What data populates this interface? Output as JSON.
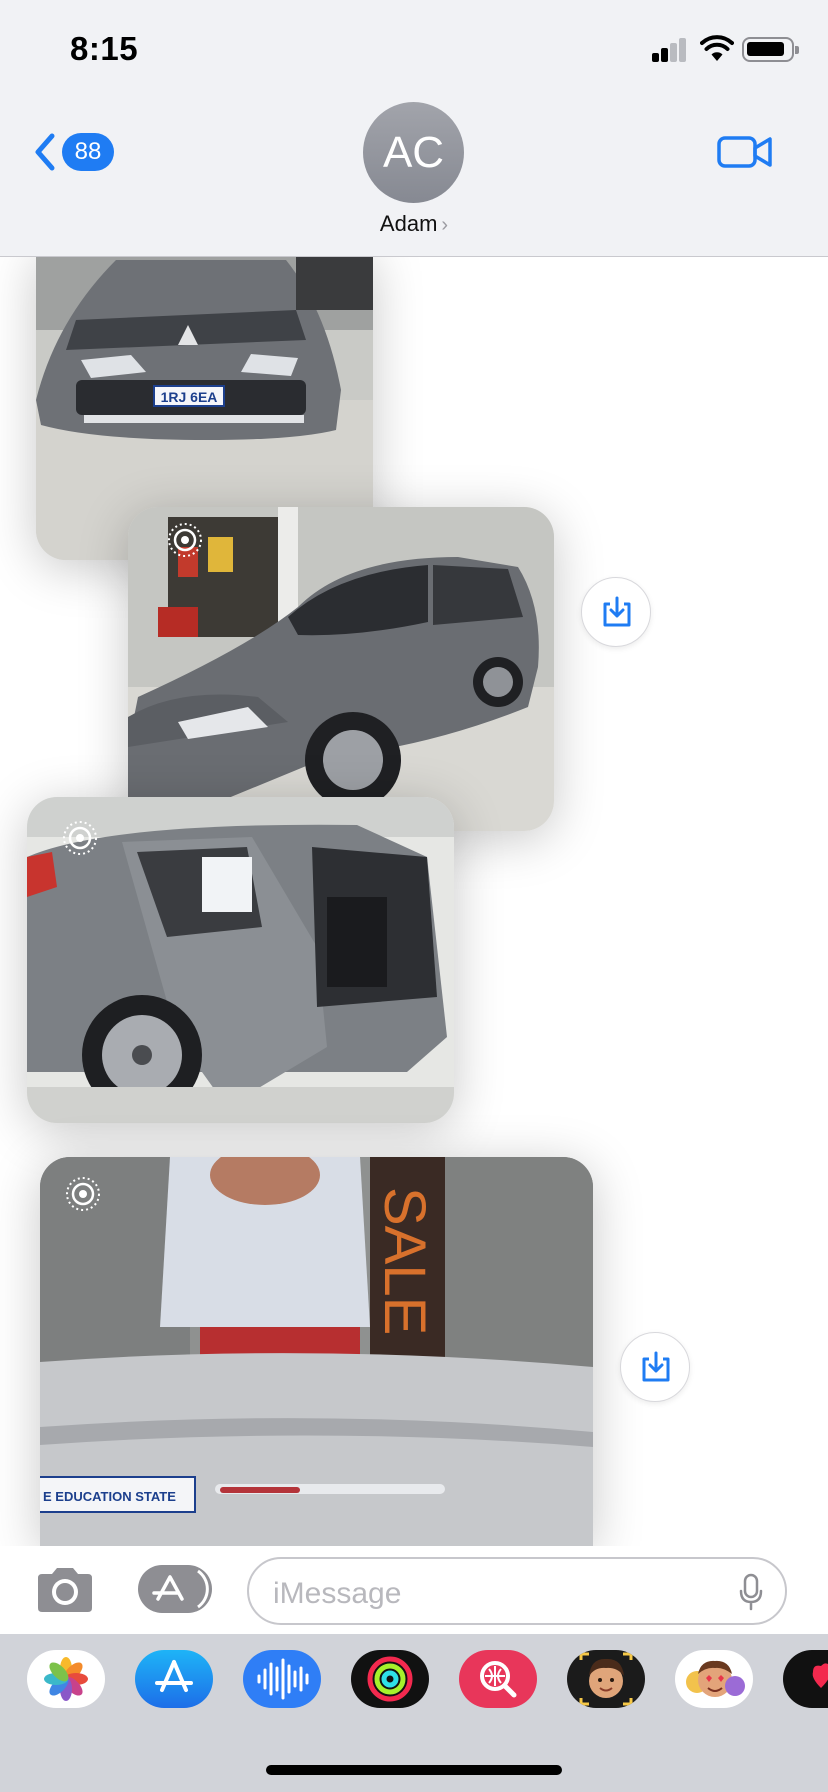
{
  "status_bar": {
    "time": "8:15"
  },
  "header": {
    "back_badge": "88",
    "contact_initials": "AC",
    "contact_name": "Adam",
    "name_chevron": "›"
  },
  "conversation": {
    "photos": [
      {
        "subject": "Grey SUV front view",
        "plate_text": "1RJ 6EA"
      },
      {
        "subject": "Grey SUV side-front view",
        "live_photo": true,
        "save_button": true
      },
      {
        "subject": "Grey SUV with rear door open",
        "live_photo": true
      },
      {
        "subject": "Close-up reflection on silver car body",
        "live_photo": true,
        "save_button": true,
        "reflected_text": "SALE",
        "plate_text": "E EDUCATION STATE"
      }
    ]
  },
  "input_bar": {
    "placeholder": "iMessage"
  },
  "app_drawer": {
    "apps": [
      {
        "name": "Photos",
        "icon": "photos-icon",
        "color": "#ffffff"
      },
      {
        "name": "App Store",
        "icon": "app-store-icon",
        "color": "#1f8ef1"
      },
      {
        "name": "Audio",
        "icon": "audio-wave-icon",
        "color": "#2f7ef6"
      },
      {
        "name": "Fitness",
        "icon": "activity-rings-icon",
        "color": "#111111"
      },
      {
        "name": "Images",
        "icon": "image-search-icon",
        "color": "#e8365a"
      },
      {
        "name": "Memoji",
        "icon": "memoji-icon",
        "color": "#1b1b1b"
      },
      {
        "name": "Memoji Stickers",
        "icon": "memoji-stickers-icon",
        "color": "#ffffff"
      },
      {
        "name": "Digital Touch",
        "icon": "digital-touch-icon",
        "color": "#111111"
      }
    ]
  },
  "colors": {
    "accent": "#1f7cf3",
    "header_bg": "#f1f2f5",
    "drawer_bg": "#d1d3d9"
  }
}
